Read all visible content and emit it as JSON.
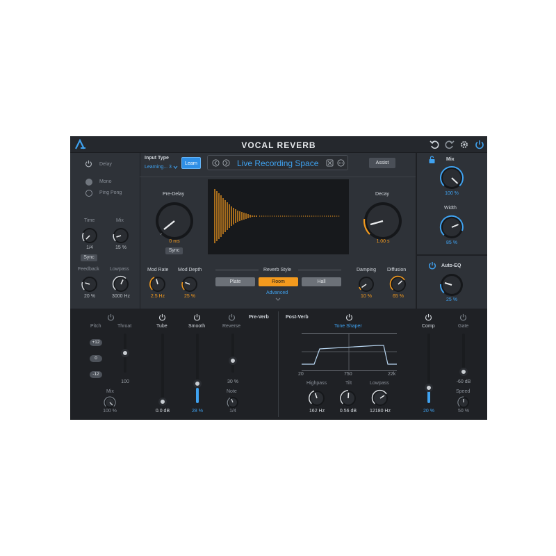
{
  "app": {
    "title": "VOCAL REVERB"
  },
  "colors": {
    "accent_orange": "#f39a1e",
    "accent_blue": "#3fa2f0",
    "panel": "#2e3238",
    "dark": "#1e2024"
  },
  "toolbar": {
    "icons": [
      "undo-icon",
      "redo-icon",
      "gear-icon",
      "power-icon"
    ]
  },
  "delay": {
    "label": "Delay",
    "mono": "Mono",
    "pingpong": "Ping Pong",
    "time_label": "Time",
    "time_value": "1/4",
    "sync": "Sync",
    "mix_label": "Mix",
    "mix_value": "15 %",
    "feedback_label": "Feedback",
    "feedback_value": "20 %",
    "lowpass_label": "Lowpass",
    "lowpass_value": "3000 Hz"
  },
  "input": {
    "label": "Input Type",
    "value": "Learning... 3",
    "learn": "Learn"
  },
  "preset": {
    "name": "Live Recording Space",
    "assist": "Assist"
  },
  "main": {
    "predelay_label": "Pre-Delay",
    "predelay_value": "0 ms",
    "sync": "Sync",
    "decay_label": "Decay",
    "decay_value": "1.00 s",
    "modrate_label": "Mod Rate",
    "modrate_value": "2.5 Hz",
    "moddepth_label": "Mod Depth",
    "moddepth_value": "25 %",
    "style_label": "Reverb Style",
    "styles": [
      "Plate",
      "Room",
      "Hall"
    ],
    "selected_style": "Room",
    "advanced": "Advanced",
    "damping_label": "Damping",
    "damping_value": "10 %",
    "diffusion_label": "Diffusion",
    "diffusion_value": "65 %"
  },
  "right": {
    "mix_label": "Mix",
    "mix_value": "100 %",
    "width_label": "Width",
    "width_value": "85 %",
    "autoeq_label": "Auto-EQ",
    "autoeq_value": "25 %"
  },
  "bottom": {
    "pitch_label": "Pitch",
    "throat_label": "Throat",
    "throat_value": "100",
    "pitch_buttons": [
      "+12",
      "0",
      "-12"
    ],
    "pitch_mix_label": "Mix",
    "pitch_mix_value": "100 %",
    "tube_label": "Tube",
    "tube_value": "0.0 dB",
    "smooth_label": "Smooth",
    "smooth_value": "28 %",
    "reverse_label": "Reverse",
    "reverse_value": "30 %",
    "note_label": "Note",
    "note_value": "1/4",
    "preverb_label": "Pre-Verb",
    "postverb_label": "Post-Verb",
    "toneshaper_label": "Tone Shaper",
    "eq_axis": [
      "20",
      "750",
      "22k"
    ],
    "highpass_label": "Highpass",
    "highpass_value": "162 Hz",
    "tilt_label": "Tilt",
    "tilt_value": "0.56 dB",
    "lowpass_label": "Lowpass",
    "lowpass_value": "12180 Hz",
    "comp_label": "Comp",
    "comp_value": "20 %",
    "gate_label": "Gate",
    "gate_value": "-60 dB",
    "speed_label": "Speed",
    "speed_value": "50 %"
  }
}
